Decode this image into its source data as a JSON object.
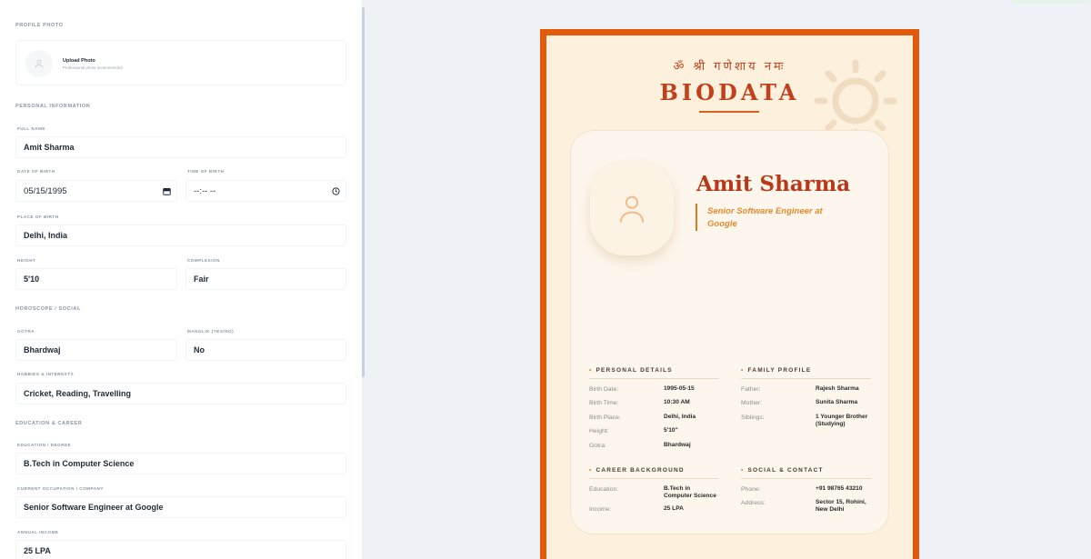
{
  "form": {
    "profile_photo": {
      "section_title": "PROFILE PHOTO",
      "upload_title": "Upload Photo",
      "upload_subtitle": "Professional photo recommended"
    },
    "personal": {
      "section_title": "PERSONAL INFORMATION",
      "full_name_label": "FULL NAME",
      "full_name": "Amit Sharma",
      "dob_label": "DATE OF BIRTH",
      "dob": "05/15/1995",
      "tob_label": "TIME OF BIRTH",
      "tob": "--:-- --",
      "pob_label": "PLACE OF BIRTH",
      "pob": "Delhi, India",
      "height_label": "HEIGHT",
      "height": "5'10",
      "complexion_label": "COMPLEXION",
      "complexion": "Fair"
    },
    "horoscope": {
      "section_title": "HOROSCOPE / SOCIAL",
      "gotra_label": "GOTRA",
      "gotra": "Bhardwaj",
      "manglik_label": "MANGLIK (YES/NO)",
      "manglik": "No",
      "hobbies_label": "HOBBIES & INTERESTS",
      "hobbies": "Cricket, Reading, Travelling"
    },
    "education": {
      "section_title": "EDUCATION & CAREER",
      "degree_label": "EDUCATION / DEGREE",
      "degree": "B.Tech in Computer Science",
      "occupation_label": "CURRENT OCCUPATION / COMPANY",
      "occupation": "Senior Software Engineer at Google",
      "income_label": "ANNUAL INCOME",
      "income": "25 LPA"
    }
  },
  "biodata": {
    "mantra": "ॐ श्री गणेशाय नमः",
    "title": "BIODATA",
    "name": "Amit Sharma",
    "occupation": "Senior Software Engineer at Google",
    "personal": {
      "heading": "PERSONAL DETAILS",
      "rows": [
        {
          "key": "Birth Date:",
          "value": "1995-05-15"
        },
        {
          "key": "Birth Time:",
          "value": "10:30 AM"
        },
        {
          "key": "Birth Place:",
          "value": "Delhi, India"
        },
        {
          "key": "Height:",
          "value": "5'10\""
        },
        {
          "key": "Gotra:",
          "value": "Bhardwaj"
        }
      ]
    },
    "family": {
      "heading": "FAMILY PROFILE",
      "rows": [
        {
          "key": "Father:",
          "value": "Rajesh Sharma"
        },
        {
          "key": "Mother:",
          "value": "Sunita Sharma"
        },
        {
          "key": "Siblings:",
          "value": "1 Younger Brother (Studying)"
        }
      ]
    },
    "career": {
      "heading": "CAREER BACKGROUND",
      "rows": [
        {
          "key": "Education:",
          "value": "B.Tech in Computer Science"
        },
        {
          "key": "Income:",
          "value": "25 LPA"
        }
      ]
    },
    "social": {
      "heading": "SOCIAL & CONTACT",
      "rows": [
        {
          "key": "Phone:",
          "value": "+91 98765 43210"
        },
        {
          "key": "Address:",
          "value": "Sector 15, Rohini, New Delhi"
        }
      ]
    }
  },
  "colors": {
    "frame": "#e35a0a",
    "accent": "#c0411c",
    "paper": "#fdf1de"
  },
  "icons": {
    "avatar": "user-icon",
    "calendar": "calendar-icon",
    "clock": "clock-icon",
    "sun": "sun-icon"
  }
}
